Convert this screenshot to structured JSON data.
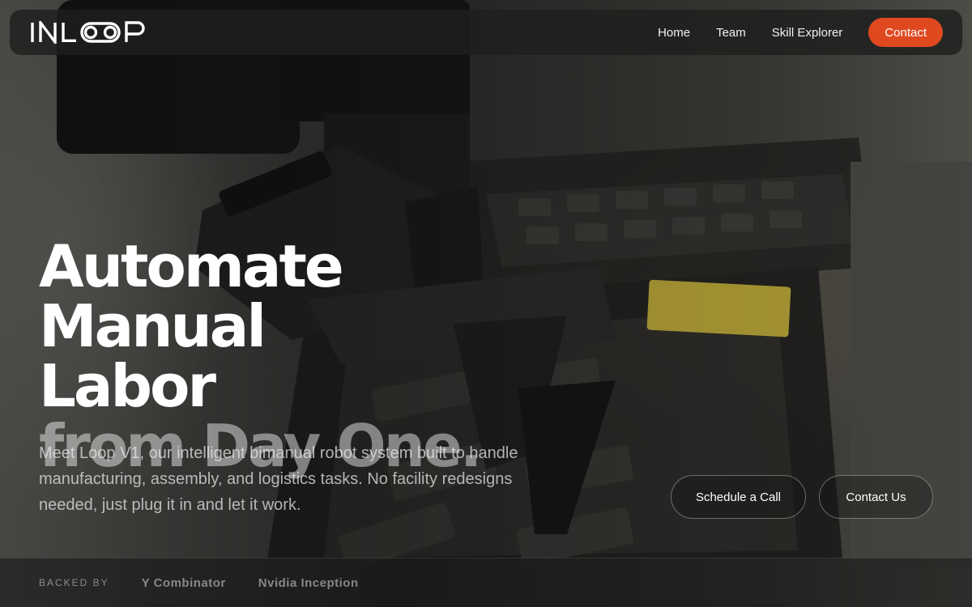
{
  "brand": {
    "logo_text": "INLOOP",
    "accent": "#e0491f"
  },
  "nav": {
    "items": [
      {
        "label": "Home"
      },
      {
        "label": "Team"
      },
      {
        "label": "Skill Explorer"
      }
    ],
    "cta_label": "Contact"
  },
  "hero": {
    "headline_line1": "Automate Manual",
    "headline_line2": "Labor",
    "headline_line3": "from Day One.",
    "subtitle": "Meet Loop V1, our intelligent bimanual robot system built to handle manufacturing, assembly, and logistics tasks. No facility redesigns needed, just plug it in and let it work.",
    "primary_button": "Schedule a Call",
    "secondary_button": "Contact Us"
  },
  "backed_by": {
    "label": "BACKED BY",
    "backers": [
      "Y Combinator",
      "Nvidia Inception"
    ]
  }
}
